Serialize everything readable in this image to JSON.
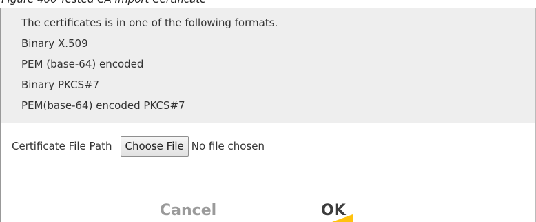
{
  "figure": {
    "caption": "Figure 400   Tested CA Import Certificate"
  },
  "info": {
    "lines": [
      "The certificates is in one of the following formats.",
      "Binary X.509",
      "PEM (base-64) encoded",
      "Binary PKCS#7",
      "PEM(base-64) encoded PKCS#7"
    ]
  },
  "form": {
    "file_path_label": "Certificate File Path",
    "choose_file_label": "Choose File",
    "no_file_text": "No file chosen"
  },
  "actions": {
    "cancel_label": "Cancel",
    "ok_label": "OK"
  },
  "colors": {
    "panel_background": "#eeeeee",
    "ok_accent": "#ffc20e",
    "cancel_text": "#9a9a9a"
  }
}
